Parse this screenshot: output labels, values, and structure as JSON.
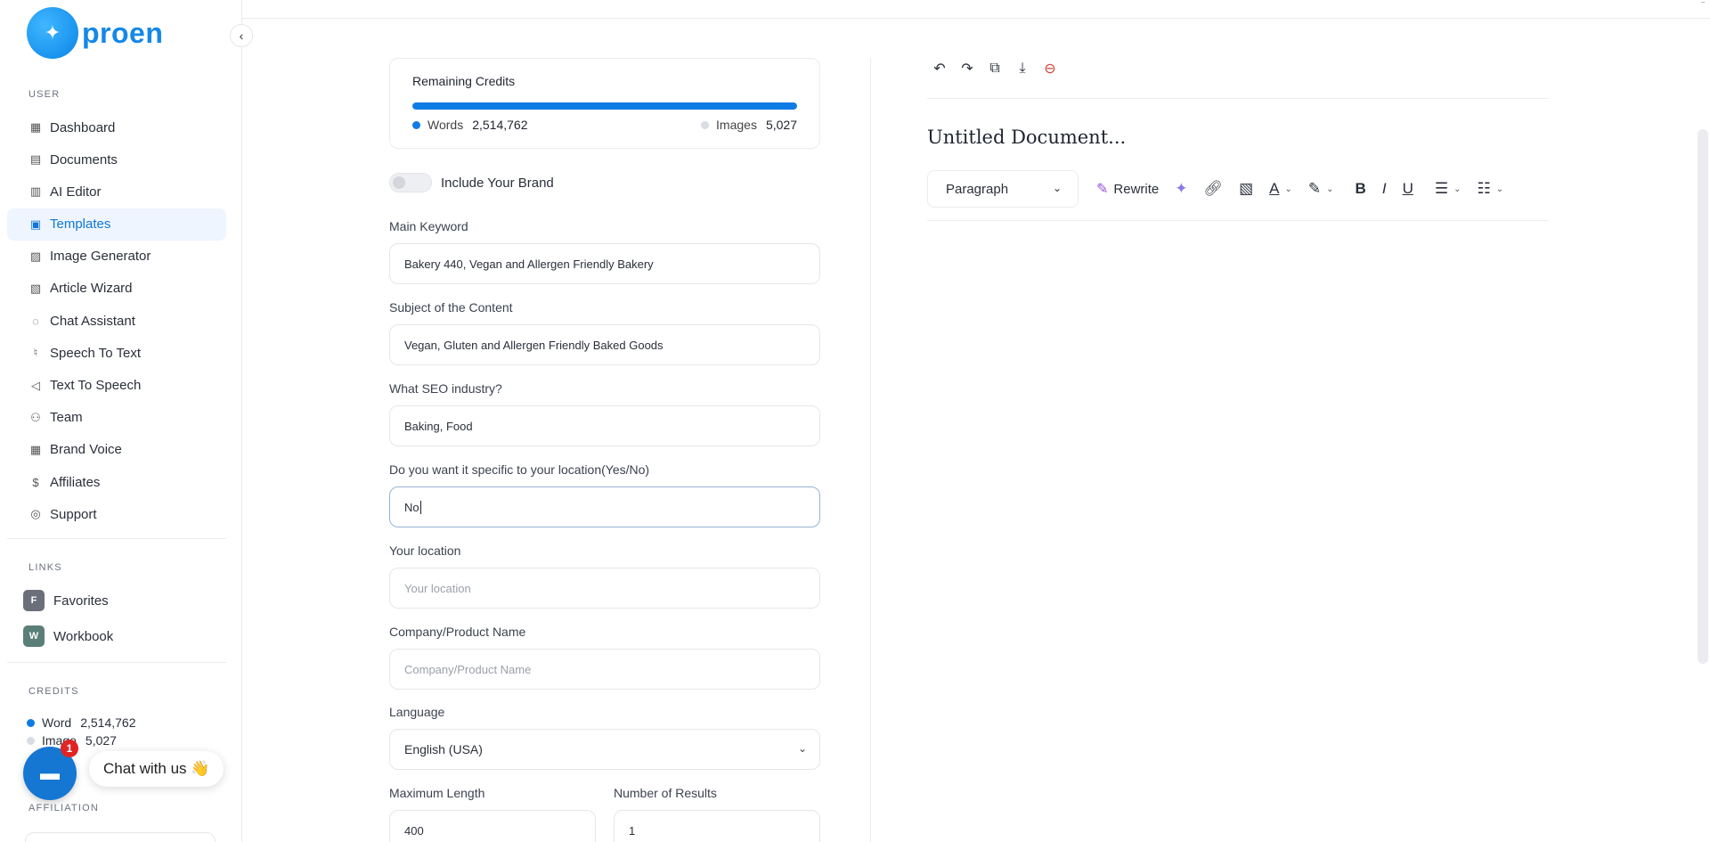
{
  "brand": {
    "name": "proen"
  },
  "sidebar": {
    "user_label": "USER",
    "items": [
      {
        "label": "Dashboard",
        "icon": "grid-icon"
      },
      {
        "label": "Documents",
        "icon": "archive-icon"
      },
      {
        "label": "AI Editor",
        "icon": "book-icon"
      },
      {
        "label": "Templates",
        "icon": "file-text-icon",
        "active": true
      },
      {
        "label": "Image Generator",
        "icon": "image-icon"
      },
      {
        "label": "Article Wizard",
        "icon": "file-edit-icon"
      },
      {
        "label": "Chat Assistant",
        "icon": "message-icon"
      },
      {
        "label": "Speech To Text",
        "icon": "mic-icon"
      },
      {
        "label": "Text To Speech",
        "icon": "volume-icon"
      },
      {
        "label": "Team",
        "icon": "user-plus-icon"
      },
      {
        "label": "Brand Voice",
        "icon": "layout-icon"
      },
      {
        "label": "Affiliates",
        "icon": "dollar-icon"
      },
      {
        "label": "Support",
        "icon": "lifebuoy-icon"
      }
    ],
    "links_label": "LINKS",
    "links": [
      {
        "badge": "F",
        "label": "Favorites",
        "color": "#6b6f7a"
      },
      {
        "badge": "W",
        "label": "Workbook",
        "color": "#5a7f78"
      }
    ],
    "credits_label": "CREDITS",
    "credits": [
      {
        "label": "Word",
        "value": "2,514,762",
        "color": "#0f7be5"
      },
      {
        "label": "Image",
        "value": "5,027",
        "color": "#d9dde3"
      }
    ],
    "affiliation_label": "AFFILIATION"
  },
  "chat_widget": {
    "label": "Chat with us 👋",
    "badge": "1"
  },
  "credits_card": {
    "title": "Remaining Credits",
    "progress": 1.0,
    "words_label": "Words",
    "words_value": "2,514,762",
    "images_label": "Images",
    "images_value": "5,027"
  },
  "form": {
    "brand_toggle_label": "Include Your Brand",
    "main_keyword": {
      "label": "Main Keyword",
      "value": "Bakery 440, Vegan and Allergen Friendly Bakery"
    },
    "subject": {
      "label": "Subject of the Content",
      "value": "Vegan, Gluten and Allergen Friendly Baked Goods"
    },
    "industry": {
      "label": "What SEO industry?",
      "value": "Baking, Food"
    },
    "location_specific": {
      "label": "Do you want it specific to your location(Yes/No)",
      "value": "No"
    },
    "location": {
      "label": "Your location",
      "placeholder": "Your location"
    },
    "company": {
      "label": "Company/Product Name",
      "placeholder": "Company/Product Name"
    },
    "language": {
      "label": "Language",
      "value": "English (USA)"
    },
    "max_length": {
      "label": "Maximum Length",
      "value": "400"
    },
    "num_results": {
      "label": "Number of Results",
      "value": "1"
    }
  },
  "editor": {
    "doc_title": "Untitled Document...",
    "paragraph_select": "Paragraph",
    "rewrite_label": "Rewrite"
  }
}
